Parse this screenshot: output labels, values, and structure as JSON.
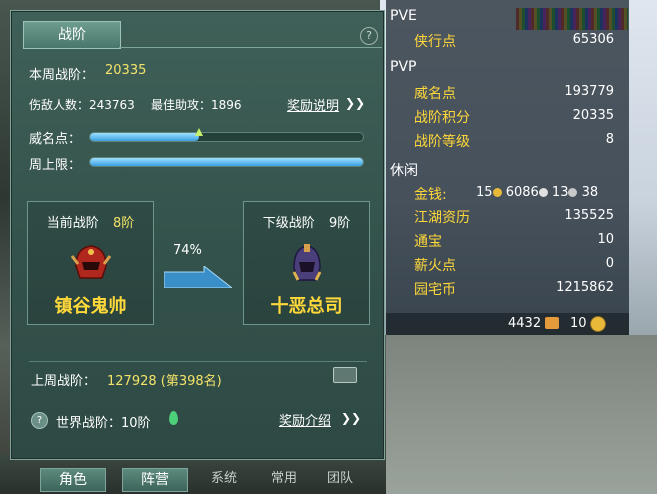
{
  "panel": {
    "tab_label": "战阶",
    "help_icon": "?",
    "weekly_rank_label": "本周战阶：",
    "weekly_rank_value": "20335",
    "kills_label": "伤敌人数：243763",
    "best_assist_label": "最佳助攻：1896",
    "reward_desc_link": "奖励说明",
    "prestige_label": "威名点：",
    "prestige_progress": 0.4,
    "weekly_cap_label": "周上限：",
    "weekly_cap_progress": 1.0,
    "current_rank": {
      "title": "当前战阶",
      "level": "8阶",
      "name": "镇谷鬼帅"
    },
    "next_rank": {
      "title": "下级战阶",
      "level": "9阶",
      "name": "十恶总司"
    },
    "progress_percent": "74%",
    "last_week_label": "上周战阶：",
    "last_week_value": "127928 (第398名)",
    "world_rank_label": "世界战阶：10阶",
    "reward_intro_link": "奖励介绍"
  },
  "info": {
    "pve": {
      "head": "PVE",
      "rows": [
        {
          "label": "侠行点",
          "value": "65306"
        }
      ]
    },
    "pvp": {
      "head": "PVP",
      "rows": [
        {
          "label": "威名点",
          "value": "193779"
        },
        {
          "label": "战阶积分",
          "value": "20335"
        },
        {
          "label": "战阶等级",
          "value": "8"
        }
      ]
    },
    "leisure": {
      "head": "休闲",
      "rows": [
        {
          "label": "金钱:",
          "value": "15"
        },
        {
          "label": "江湖资历",
          "value": "135525"
        },
        {
          "label": "通宝",
          "value": "10"
        },
        {
          "label": "薪火点",
          "value": "0"
        },
        {
          "label": "园宅币",
          "value": "1215862"
        }
      ]
    },
    "money_parts": {
      "gold": "15",
      "silver": "6086",
      "copper_a": "13",
      "copper_b": "38"
    },
    "bottom": {
      "left_value": "4432",
      "right_value": "10"
    }
  },
  "bottom_tabs": [
    {
      "label": "角色"
    },
    {
      "label": "阵营"
    },
    {
      "label": "系统"
    },
    {
      "label": "常用"
    },
    {
      "label": "团队"
    }
  ],
  "colors": {
    "accent": "#ffd83a",
    "panel": "#3f6058",
    "bar": "#3aa0e0"
  }
}
